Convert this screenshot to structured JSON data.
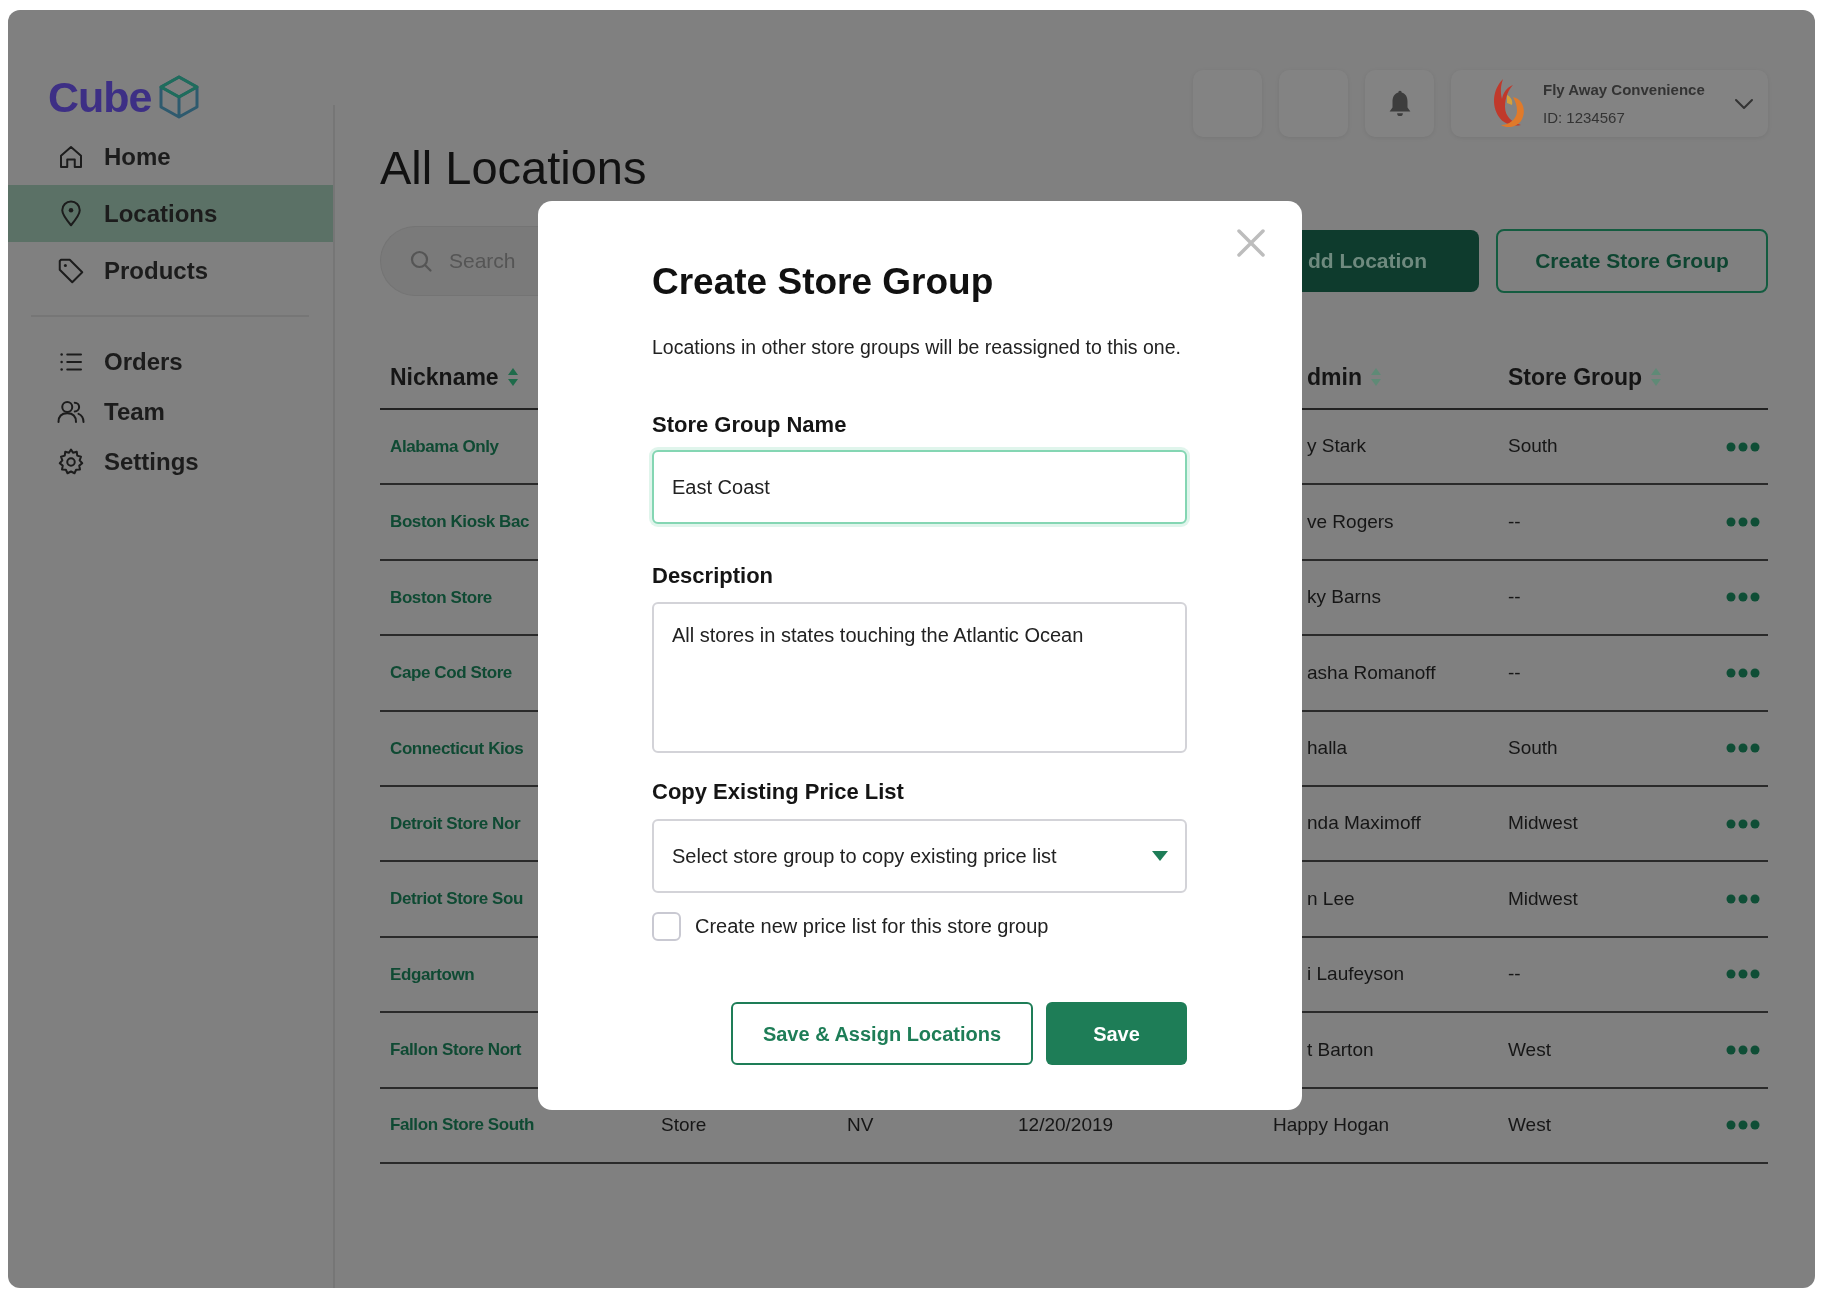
{
  "sidebar": {
    "logo": "Cube",
    "nav_groups": [
      {
        "items": [
          {
            "label": "Home",
            "selected": false
          },
          {
            "label": "Locations",
            "selected": true
          },
          {
            "label": "Products",
            "selected": false
          }
        ]
      },
      {
        "items": [
          {
            "label": "Orders",
            "selected": false
          },
          {
            "label": "Team",
            "selected": false
          },
          {
            "label": "Settings",
            "selected": false
          }
        ]
      }
    ]
  },
  "header": {
    "account": {
      "name": "Fly Away Convenience",
      "id": "ID: 1234567"
    }
  },
  "page": {
    "title": "All Locations",
    "search": {
      "placeholder": "Search"
    },
    "buttons": [
      {
        "label": "dd Location",
        "kind": "primary"
      },
      {
        "label": "Create Store Group",
        "kind": "outline"
      }
    ]
  },
  "table": {
    "columns": [
      {
        "label": "Nickname",
        "sorted": true
      },
      {
        "label": "dmin",
        "sorted": false
      },
      {
        "label": "Store Group",
        "sorted": false
      }
    ],
    "rows": [
      {
        "nickname": "Alabama Only",
        "admin": "y Stark",
        "store_group": "South"
      },
      {
        "nickname": "Boston Kiosk Bac",
        "admin": "ve Rogers",
        "store_group": "--"
      },
      {
        "nickname": "Boston Store",
        "admin": "ky Barns",
        "store_group": "--"
      },
      {
        "nickname": "Cape Cod Store",
        "admin": "asha Romanoff",
        "store_group": "--"
      },
      {
        "nickname": "Connecticut Kios",
        "admin": "halla",
        "store_group": "South"
      },
      {
        "nickname": "Detroit Store Nor",
        "admin": "nda Maximoff",
        "store_group": "Midwest"
      },
      {
        "nickname": "Detriot Store Sou",
        "admin": "n Lee",
        "store_group": "Midwest"
      },
      {
        "nickname": "Edgartown",
        "admin": "i Laufeyson",
        "store_group": "--"
      },
      {
        "nickname": "Fallon Store Nort",
        "admin": "t Barton",
        "store_group": "West"
      },
      {
        "nickname": "Fallon Store South",
        "column_2": "Store",
        "column_3": "NV",
        "column_4": "12/20/2019",
        "admin": "Happy Hogan",
        "store_group": "West"
      }
    ]
  },
  "modal": {
    "title": "Create Store Group",
    "description": "Locations in other store groups will be reassigned to this one.",
    "fields": [
      {
        "kind": "input",
        "label": "Store Group Name",
        "value": "East Coast",
        "focused": true
      },
      {
        "kind": "textarea",
        "label": "Description",
        "value": "All stores in states touching the Atlantic Ocean",
        "focused": false
      },
      {
        "kind": "select",
        "label": "Copy Existing Price List",
        "placeholder": "Select store group to copy existing price list",
        "focused": false
      }
    ],
    "checkbox": {
      "label": "Create new price list for this store group",
      "checked": false
    },
    "buttons": [
      {
        "label": "Save & Assign Locations",
        "kind": "outline"
      },
      {
        "label": "Save",
        "kind": "primary"
      }
    ]
  }
}
